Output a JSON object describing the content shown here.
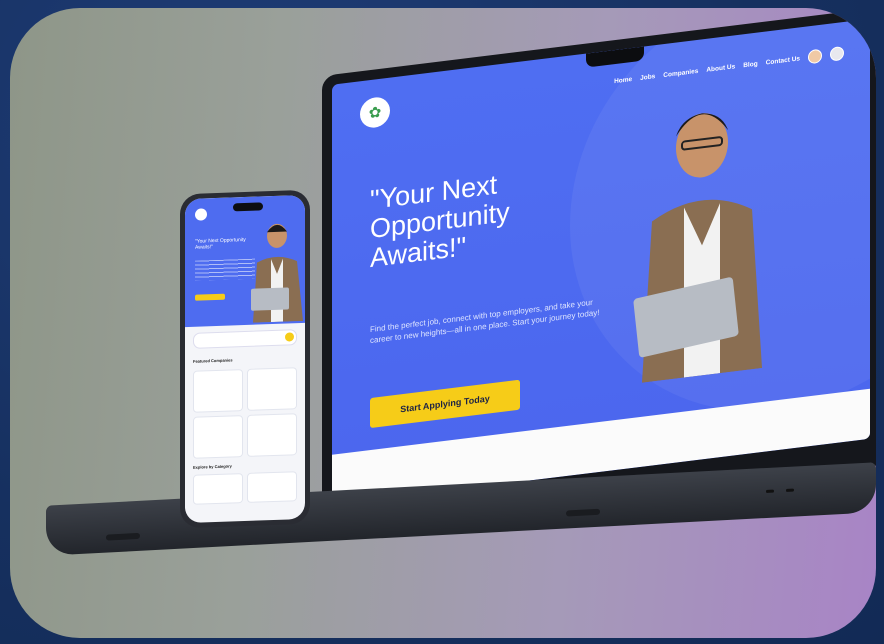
{
  "site": {
    "nav": [
      "Home",
      "Jobs",
      "Companies",
      "About Us",
      "Blog",
      "Contact Us"
    ],
    "hero_title": "\"Your Next Opportunity Awaits!\"",
    "hero_subtitle": "Find the perfect job, connect with top employers, and take your career to new heights—all in one place. Start your journey today!",
    "cta_label": "Start Applying Today"
  },
  "phone": {
    "hero_title": "\"Your Next Opportunity Awaits!\"",
    "featured_label": "Featured Companies",
    "category_label": "Explore by Category"
  },
  "colors": {
    "accent": "#4f6ef2",
    "cta": "#f6cc18"
  }
}
